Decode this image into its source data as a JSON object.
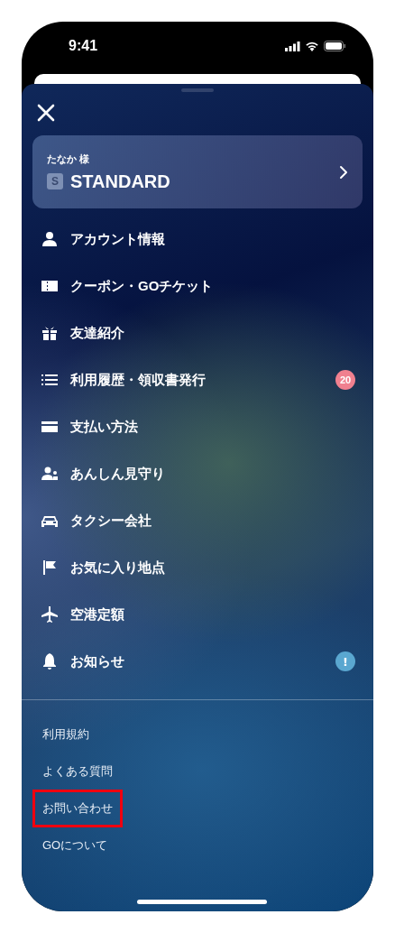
{
  "status_bar": {
    "time": "9:41"
  },
  "member_card": {
    "name": "たなか 様",
    "rank_mark": "S",
    "rank": "STANDARD"
  },
  "menu_items": [
    {
      "label": "アカウント情報"
    },
    {
      "label": "クーポン・GOチケット"
    },
    {
      "label": "友達紹介"
    },
    {
      "label": "利用履歴・領収書発行",
      "badge": {
        "kind": "count",
        "text": "20",
        "color": "#f0808f"
      }
    },
    {
      "label": "支払い方法"
    },
    {
      "label": "あんしん見守り"
    },
    {
      "label": "タクシー会社"
    },
    {
      "label": "お気に入り地点"
    },
    {
      "label": "空港定額"
    },
    {
      "label": "お知らせ",
      "badge": {
        "kind": "alert",
        "text": "!",
        "color": "#5aa7d0"
      }
    }
  ],
  "links": [
    {
      "label": "利用規約",
      "highlighted": false
    },
    {
      "label": "よくある質問",
      "highlighted": false
    },
    {
      "label": "お問い合わせ",
      "highlighted": true
    },
    {
      "label": "GOについて",
      "highlighted": false
    }
  ]
}
